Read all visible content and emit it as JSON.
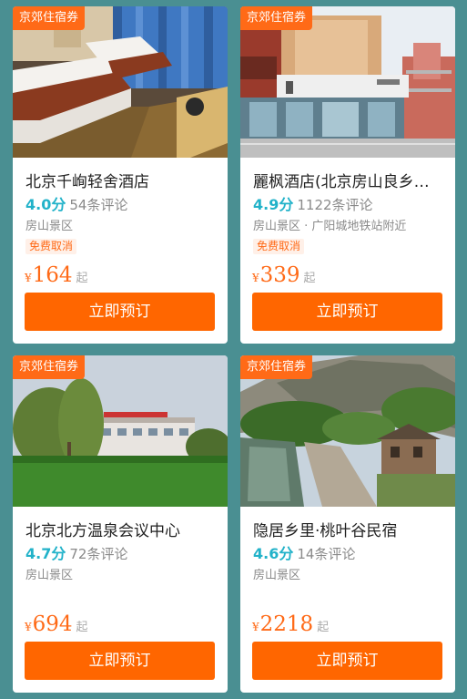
{
  "hotels": [
    {
      "tag": "京郊住宿券",
      "name": "北京千峋轻舍酒店",
      "score": "4.0分",
      "reviews": "54条评论",
      "area": "房山景区",
      "badge": "免费取消",
      "currency": "¥",
      "price": "164",
      "price_suffix": "起",
      "button": "立即预订"
    },
    {
      "tag": "京郊住宿券",
      "name": "麗枫酒店(北京房山良乡大学城店)",
      "score": "4.9分",
      "reviews": "1122条评论",
      "area": "房山景区 · 广阳城地铁站附近",
      "badge": "免费取消",
      "currency": "¥",
      "price": "339",
      "price_suffix": "起",
      "button": "立即预订"
    },
    {
      "tag": "京郊住宿券",
      "name": "北京北方温泉会议中心",
      "score": "4.7分",
      "reviews": "72条评论",
      "area": "房山景区",
      "currency": "¥",
      "price": "694",
      "price_suffix": "起",
      "button": "立即预订"
    },
    {
      "tag": "京郊住宿券",
      "name": "隐居乡里·桃叶谷民宿",
      "score": "4.6分",
      "reviews": "14条评论",
      "area": "房山景区",
      "currency": "¥",
      "price": "2218",
      "price_suffix": "起",
      "button": "立即预订"
    }
  ],
  "colors": {
    "page_background": "#4a8f92",
    "accent": "#ff6600",
    "score": "#22b2c9"
  }
}
